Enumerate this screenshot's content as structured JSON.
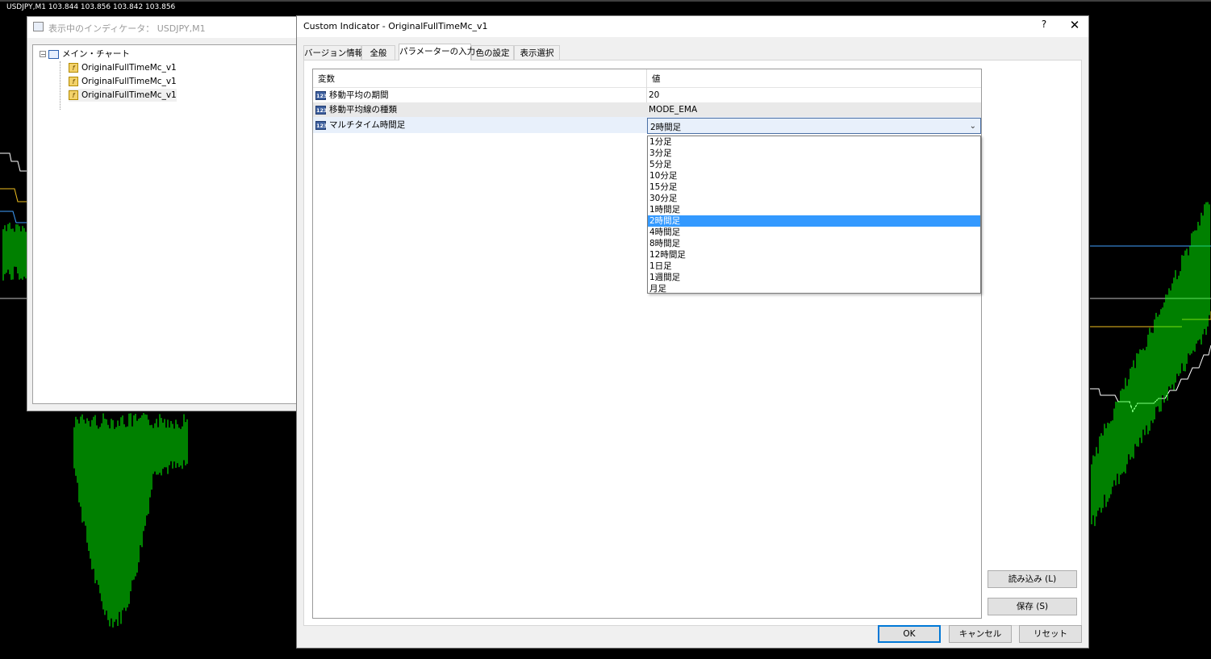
{
  "chart": {
    "label": "USDJPY,M1  103.844 103.856 103.842 103.856",
    "colors": {
      "background": "#000000",
      "candles": "#00ff00",
      "line_orange": "#f0c020",
      "line_blue": "#3fa0ff",
      "line_white": "#ffffff"
    }
  },
  "indicators_window": {
    "title": "表示中のインディケータ： USDJPY,M1",
    "tree_root": "メイン・チャート",
    "items": [
      "OriginalFullTimeMc_v1",
      "OriginalFullTimeMc_v1",
      "OriginalFullTimeMc_v1"
    ]
  },
  "dialog": {
    "title": "Custom Indicator - OriginalFullTimeMc_v1",
    "help": "?",
    "close": "✕",
    "tabs": [
      "バージョン情報",
      "全般",
      "パラメーターの入力",
      "色の設定",
      "表示選択"
    ],
    "active_tab": 2,
    "grid": {
      "headers": {
        "variable": "変数",
        "value": "値"
      },
      "rows": [
        {
          "icon": "123",
          "name": "移動平均の期間",
          "value": "20"
        },
        {
          "icon": "123",
          "name": "移動平均線の種類",
          "value": "MODE_EMA"
        },
        {
          "icon": "123",
          "name": "マルチタイム時間足",
          "value": "2時間足"
        }
      ]
    },
    "dropdown": {
      "options": [
        "1分足",
        "3分足",
        "5分足",
        "10分足",
        "15分足",
        "30分足",
        "1時間足",
        "2時間足",
        "4時間足",
        "8時間足",
        "12時間足",
        "1日足",
        "1週間足",
        "月足"
      ],
      "selected": "2時間足"
    },
    "side_buttons": {
      "load": "読み込み (L)",
      "save": "保存 (S)"
    },
    "buttons": {
      "ok": "OK",
      "cancel": "キャンセル",
      "reset": "リセット"
    }
  }
}
